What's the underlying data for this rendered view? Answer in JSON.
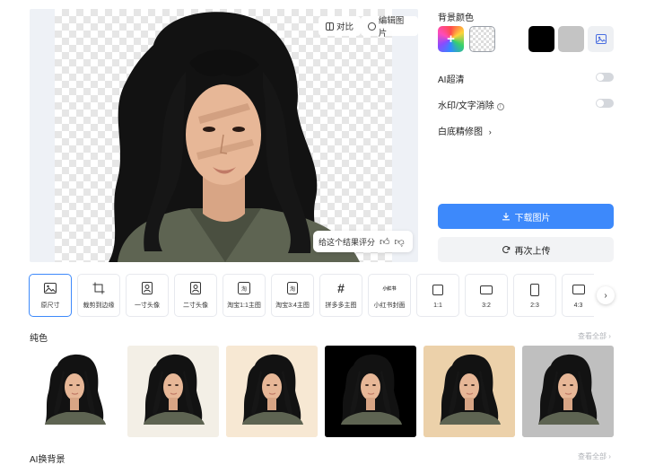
{
  "preview": {
    "compare_label": "对比",
    "edit_label": "编辑图片",
    "rate_prompt": "给这个结果评分"
  },
  "right_panel": {
    "bg_color_title": "背景颜色",
    "swatches": [
      {
        "name": "color-picker"
      },
      {
        "name": "transparent",
        "selected": true
      },
      {
        "name": "white",
        "color": "#ffffff"
      },
      {
        "name": "black",
        "color": "#000000"
      },
      {
        "name": "gray",
        "color": "#c4c4c4"
      },
      {
        "name": "upload-background"
      }
    ],
    "ai_hd_label": "AI超清",
    "ai_hd_enabled": false,
    "watermark_label": "水印/文字消除",
    "watermark_enabled": false,
    "white_bg_retouch_label": "白底精修图",
    "download_label": "下载图片",
    "reupload_label": "再次上传",
    "accent_color": "#3d89fb"
  },
  "size_tools": [
    {
      "label": "原尺寸",
      "icon": "image-icon",
      "active": true
    },
    {
      "label": "裁剪到边缘",
      "icon": "crop-icon"
    },
    {
      "label": "一寸头像",
      "icon": "id-photo-icon"
    },
    {
      "label": "二寸头像",
      "icon": "id-photo-icon"
    },
    {
      "label": "淘宝1:1主图",
      "icon": "taobao-icon"
    },
    {
      "label": "淘宝3:4主图",
      "icon": "taobao-icon"
    },
    {
      "label": "拼多多主图",
      "icon": "pinduoduo-icon"
    },
    {
      "label": "小红书封面",
      "icon": "xiaohongshu-icon"
    },
    {
      "label": "1:1",
      "icon": "square-icon"
    },
    {
      "label": "3:2",
      "icon": "landscape-icon"
    },
    {
      "label": "2:3",
      "icon": "portrait-icon"
    },
    {
      "label": "4:3",
      "icon": "landscape-icon"
    }
  ],
  "sections": {
    "solid_title": "纯色",
    "ai_bg_title": "AI换背景",
    "see_all_label": "查看全部"
  },
  "solid_backgrounds": [
    {
      "color": "#ffffff"
    },
    {
      "color": "#f3efe6"
    },
    {
      "color": "#f7e8d3"
    },
    {
      "color": "#000000"
    },
    {
      "color": "#ecd1aa"
    },
    {
      "color": "#bfbfbf"
    }
  ],
  "icons": {
    "xiaohongshu_glyph": "小红书",
    "taobao_glyph": "淘"
  }
}
